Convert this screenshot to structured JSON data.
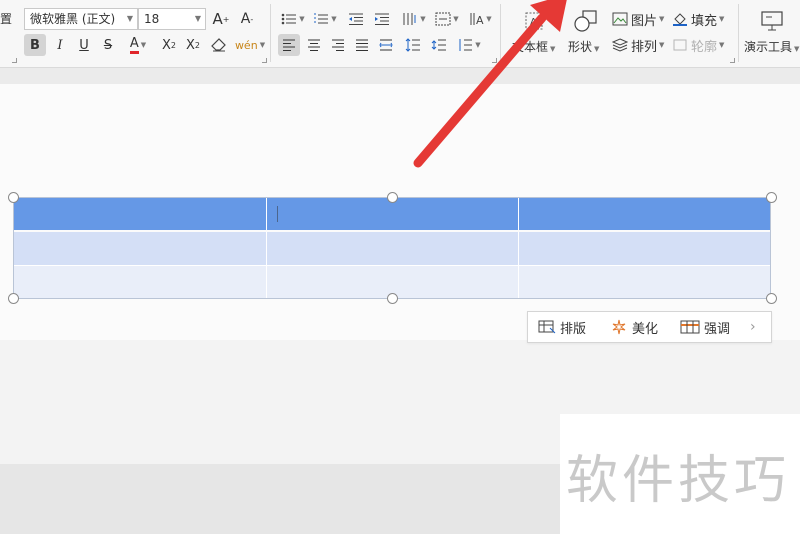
{
  "ribbon": {
    "partial_label_left": "置",
    "font_name": "微软雅黑 (正文)",
    "font_size": "18",
    "grow_font": "A",
    "shrink_font": "A",
    "bold": "B",
    "italic": "I",
    "underline": "U",
    "strikethrough": "S",
    "font_color": "A",
    "superscript": "X",
    "subscript": "X",
    "textbox_label": "文本框",
    "shape_label": "形状",
    "picture_label": "图片",
    "arrange_label": "排列",
    "fill_label": "填充",
    "outline_label": "轮廓",
    "presentation_tools_label": "演示工具"
  },
  "table": {
    "header_color": "#6598e6",
    "row1_color": "#d4dff6",
    "row2_color": "#e9eef9",
    "columns": 3,
    "rows": 3
  },
  "float_toolbar": {
    "layout_label": "排版",
    "beautify_label": "美化",
    "emphasize_label": "强调",
    "more_icon": "chevron-right-icon"
  },
  "watermark": {
    "text": "软件技巧"
  },
  "colors": {
    "arrow": "#e53935"
  }
}
